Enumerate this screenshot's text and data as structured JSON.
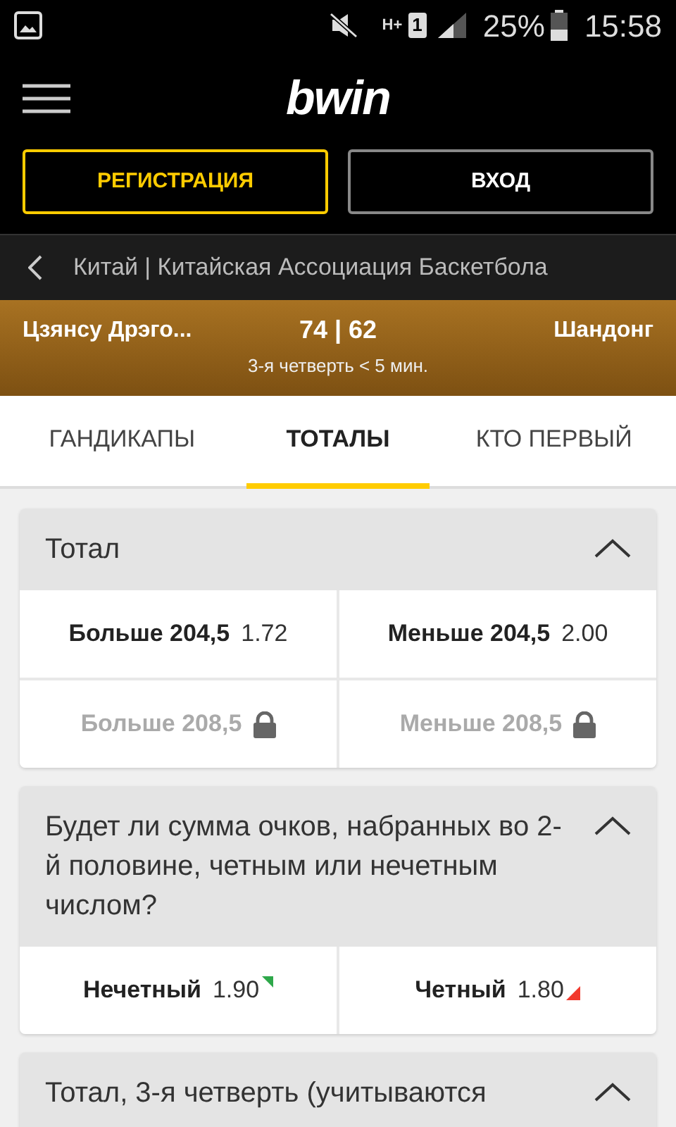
{
  "status_bar": {
    "network": "H+",
    "sim": "1",
    "battery": "25%",
    "time": "15:58"
  },
  "header": {
    "logo": "bwin",
    "buttons": [
      {
        "label": "РЕГИСТРАЦИЯ",
        "kind": "primary"
      },
      {
        "label": "ВХОД",
        "kind": "secondary"
      }
    ]
  },
  "breadcrumb": "Китай | Китайская Ассоциация Баскетбола",
  "match": {
    "home": "Цзянсу Дрэго...",
    "score": "74 | 62",
    "away": "Шандонг",
    "period": "3-я четверть < 5 мин."
  },
  "tabs": [
    {
      "label": "ГАНДИКАПЫ",
      "selected": false
    },
    {
      "label": "ТОТАЛЫ",
      "selected": true
    },
    {
      "label": "КТО ПЕРВЫЙ",
      "selected": false
    }
  ],
  "markets": [
    {
      "title": "Тотал",
      "expanded": true,
      "rows": [
        [
          {
            "label": "Больше 204,5",
            "odds": "1.72",
            "locked": false
          },
          {
            "label": "Меньше 204,5",
            "odds": "2.00",
            "locked": false
          }
        ],
        [
          {
            "label": "Больше 208,5",
            "locked": true
          },
          {
            "label": "Меньше 208,5",
            "locked": true
          }
        ]
      ]
    },
    {
      "title": "Будет ли сумма очков, набранных во 2-й половине, четным или нечетным числом?",
      "expanded": true,
      "rows": [
        [
          {
            "label": "Нечетный",
            "odds": "1.90",
            "locked": false,
            "rising": true,
            "falling": false
          },
          {
            "label": "Четный",
            "odds": "1.80",
            "locked": false,
            "rising": false,
            "falling": true
          }
        ]
      ]
    },
    {
      "title": "Тотал, 3-я четверть (учитываются",
      "expanded": true
    }
  ]
}
